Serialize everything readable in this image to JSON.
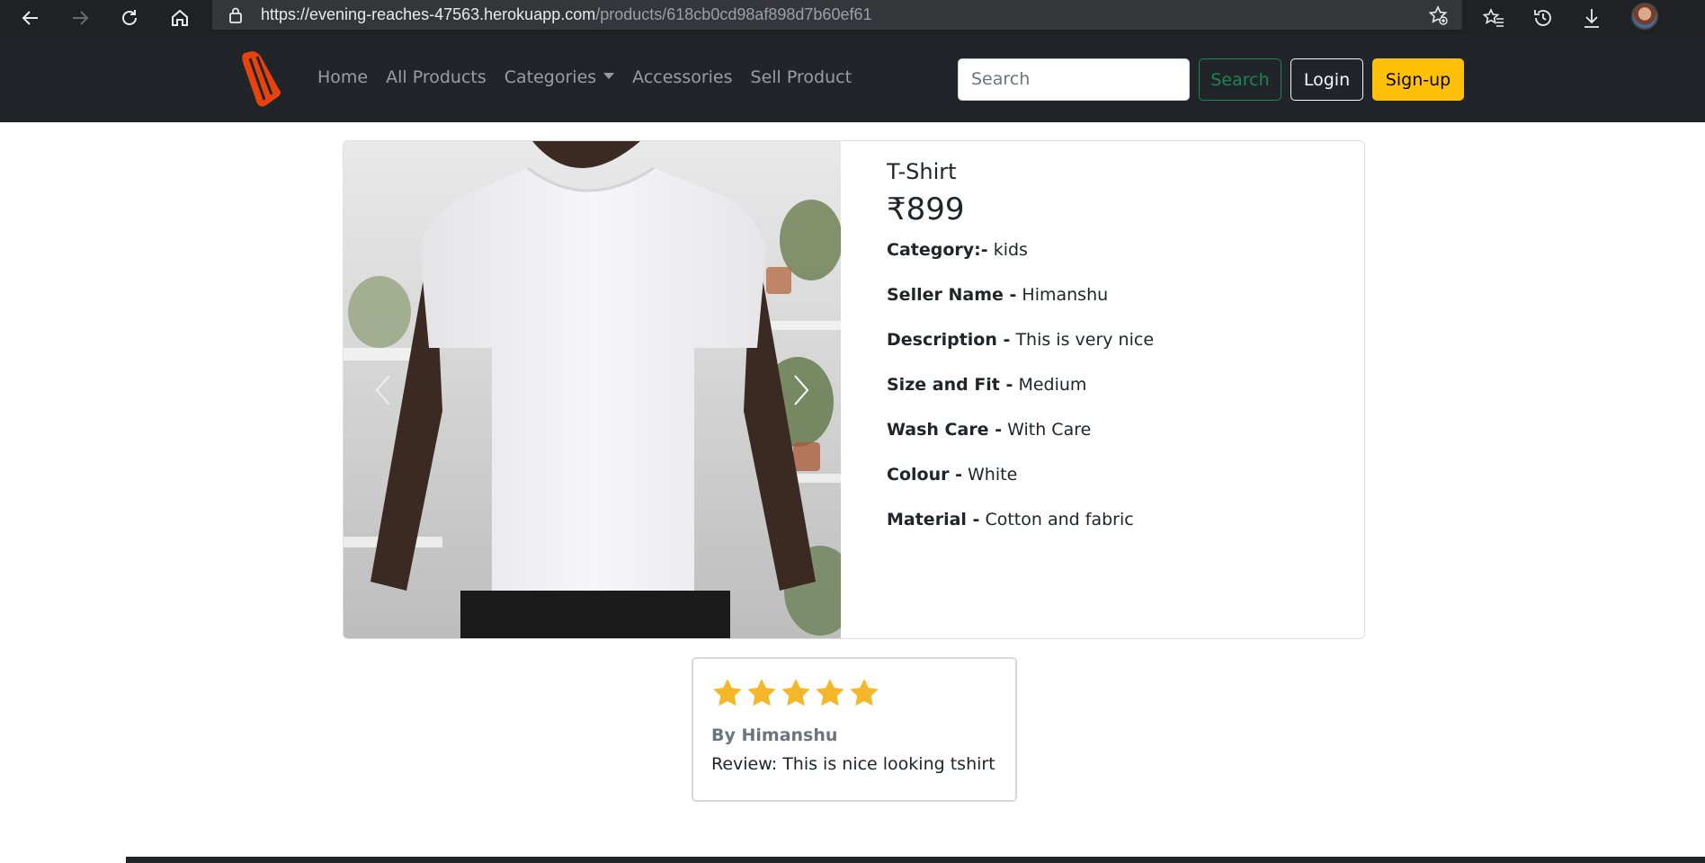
{
  "browser": {
    "url_host": "https://evening-reaches-47563.herokuapp.com",
    "url_path": "/products/618cb0cd98af898d7b60ef61",
    "icons": [
      "back-icon",
      "forward-icon",
      "reload-icon",
      "home-icon",
      "lock-icon",
      "add-favorite-icon",
      "favorites-icon",
      "history-icon",
      "downloads-icon",
      "profile-avatar"
    ]
  },
  "navbar": {
    "links": [
      "Home",
      "All Products",
      "Categories",
      "Accessories",
      "Sell Product"
    ],
    "search_placeholder": "Search",
    "search_button": "Search",
    "login_button": "Login",
    "signup_button": "Sign-up",
    "colors": {
      "bg": "#212529",
      "search_btn": "#198754",
      "signup_btn": "#ffc107",
      "logo": "#e8420e"
    }
  },
  "product": {
    "title": "T-Shirt",
    "price": "₹899",
    "fields": [
      {
        "label": "Category:-",
        "value": "kids"
      },
      {
        "label": "Seller Name -",
        "value": "Himanshu"
      },
      {
        "label": "Description -",
        "value": "This is very nice"
      },
      {
        "label": "Size and Fit -",
        "value": "Medium"
      },
      {
        "label": "Wash Care -",
        "value": "With Care"
      },
      {
        "label": "Colour -",
        "value": "White"
      },
      {
        "label": "Material -",
        "value": "Cotton and fabric"
      }
    ]
  },
  "review": {
    "rating": 5,
    "max_rating": 5,
    "author": "By Himanshu",
    "text": "Review: This is nice looking tshirt",
    "star_color": "#f4b72a"
  }
}
